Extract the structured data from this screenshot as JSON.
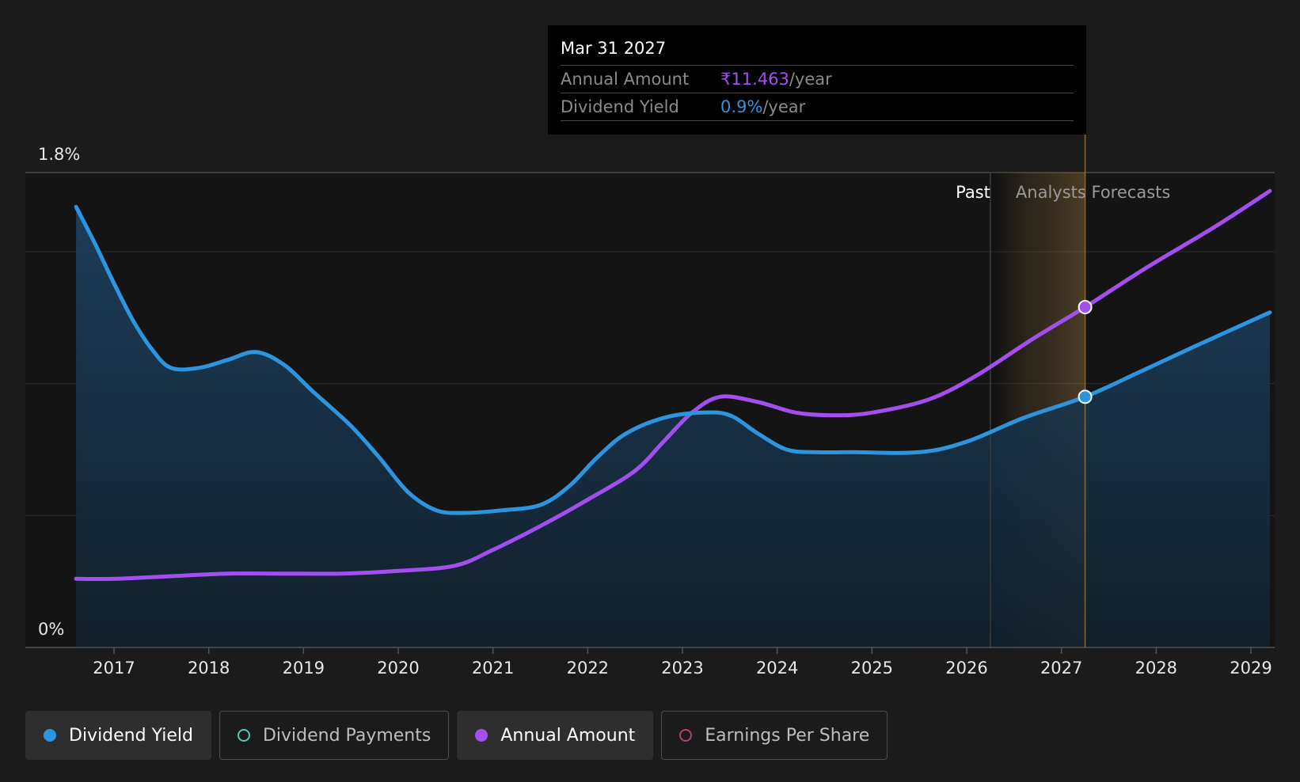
{
  "chart_data": {
    "type": "line",
    "x_unit": "year",
    "xlim": [
      2016.1,
      2029.2
    ],
    "ylim": [
      0,
      1.8
    ],
    "y_axis_labels": [
      "1.8%",
      "0%"
    ],
    "x_ticks": [
      "2017",
      "2018",
      "2019",
      "2020",
      "2021",
      "2022",
      "2023",
      "2024",
      "2025",
      "2026",
      "2027",
      "2028",
      "2029"
    ],
    "period_labels": {
      "past": "Past",
      "forecast": "Analysts Forecasts"
    },
    "past_end_x": 2026.25,
    "cursor_x": 2027.25,
    "series": [
      {
        "name": "Dividend Yield",
        "color": "#2d95e0",
        "area": true,
        "points": [
          [
            2016.6,
            1.67
          ],
          [
            2016.8,
            1.53
          ],
          [
            2017.0,
            1.38
          ],
          [
            2017.2,
            1.24
          ],
          [
            2017.4,
            1.13
          ],
          [
            2017.6,
            1.06
          ],
          [
            2017.9,
            1.06
          ],
          [
            2018.2,
            1.09
          ],
          [
            2018.5,
            1.12
          ],
          [
            2018.8,
            1.07
          ],
          [
            2019.1,
            0.97
          ],
          [
            2019.5,
            0.84
          ],
          [
            2019.8,
            0.72
          ],
          [
            2020.1,
            0.59
          ],
          [
            2020.4,
            0.52
          ],
          [
            2020.7,
            0.51
          ],
          [
            2021.1,
            0.52
          ],
          [
            2021.5,
            0.54
          ],
          [
            2021.8,
            0.61
          ],
          [
            2022.1,
            0.72
          ],
          [
            2022.4,
            0.81
          ],
          [
            2022.8,
            0.87
          ],
          [
            2023.2,
            0.89
          ],
          [
            2023.5,
            0.88
          ],
          [
            2023.8,
            0.81
          ],
          [
            2024.1,
            0.75
          ],
          [
            2024.4,
            0.74
          ],
          [
            2024.8,
            0.74
          ],
          [
            2025.5,
            0.74
          ],
          [
            2026.0,
            0.78
          ],
          [
            2026.6,
            0.87
          ],
          [
            2027.25,
            0.95
          ],
          [
            2027.8,
            1.04
          ],
          [
            2028.4,
            1.14
          ],
          [
            2029.2,
            1.27
          ]
        ]
      },
      {
        "name": "Annual Amount",
        "color": "#a34ff0",
        "area": false,
        "points": [
          [
            2016.6,
            0.26
          ],
          [
            2017.0,
            0.26
          ],
          [
            2017.6,
            0.27
          ],
          [
            2018.2,
            0.28
          ],
          [
            2018.8,
            0.28
          ],
          [
            2019.4,
            0.28
          ],
          [
            2020.0,
            0.29
          ],
          [
            2020.6,
            0.31
          ],
          [
            2021.0,
            0.37
          ],
          [
            2021.5,
            0.46
          ],
          [
            2022.0,
            0.56
          ],
          [
            2022.5,
            0.67
          ],
          [
            2022.8,
            0.78
          ],
          [
            2023.1,
            0.89
          ],
          [
            2023.4,
            0.95
          ],
          [
            2023.8,
            0.93
          ],
          [
            2024.2,
            0.89
          ],
          [
            2024.6,
            0.88
          ],
          [
            2025.0,
            0.89
          ],
          [
            2025.6,
            0.94
          ],
          [
            2026.1,
            1.03
          ],
          [
            2026.7,
            1.17
          ],
          [
            2027.25,
            1.29
          ],
          [
            2027.9,
            1.44
          ],
          [
            2028.6,
            1.59
          ],
          [
            2029.2,
            1.73
          ]
        ]
      }
    ]
  },
  "tooltip": {
    "date": "Mar 31 2027",
    "rows": [
      {
        "label": "Annual Amount",
        "value": "₹11.463",
        "unit": "/year"
      },
      {
        "label": "Dividend Yield",
        "value": "0.9%",
        "unit": "/year"
      }
    ]
  },
  "legend": [
    {
      "label": "Dividend Yield",
      "color": "#2d95e0",
      "state": "active",
      "marker": "filled"
    },
    {
      "label": "Dividend Payments",
      "color": "#5bc7b8",
      "state": "inactive",
      "marker": "hollow"
    },
    {
      "label": "Annual Amount",
      "color": "#a34ff0",
      "state": "active",
      "marker": "filled"
    },
    {
      "label": "Earnings Per Share",
      "color": "#b3407a",
      "state": "inactive",
      "marker": "hollow"
    }
  ]
}
